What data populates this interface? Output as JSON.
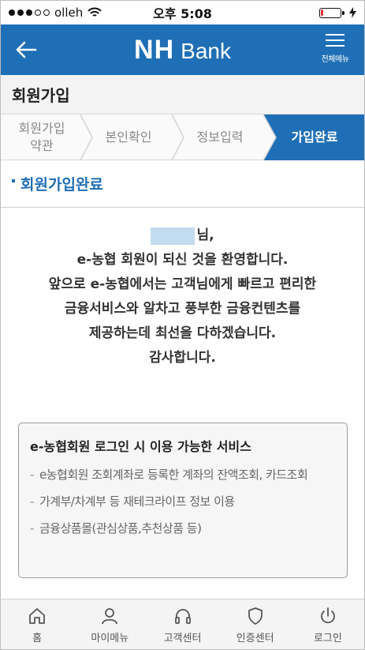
{
  "status_bar": {
    "carrier": "olleh",
    "time": "오후 5:08",
    "signal_filled": 3,
    "signal_total": 5
  },
  "header": {
    "back_icon": "arrow-left-icon",
    "logo_nh": "NH",
    "logo_bank": "Bank",
    "menu_label": "전체메뉴",
    "color": "#1f6fb6"
  },
  "page_title": "회원가입",
  "steps": [
    {
      "label": "회원가입\n약관",
      "active": false
    },
    {
      "label": "본인확인",
      "active": false
    },
    {
      "label": "정보입력",
      "active": false
    },
    {
      "label": "가입완료",
      "active": true
    }
  ],
  "section_title": "회원가입완료",
  "welcome": {
    "name_suffix": "님,",
    "line1": "e-농협 회원이 되신 것을 환영합니다.",
    "line2": "앞으로 e-농협에서는 고객님에게 빠르고 편리한",
    "line3": "금융서비스와 알차고 풍부한 금융컨텐츠를",
    "line4": "제공하는데 최선을 다하겠습니다.",
    "line5": "감사합니다."
  },
  "services": {
    "title": "e-농협회원 로그인 시 이용 가능한 서비스",
    "items": [
      "e농협회원 조회계좌로 등록한 계좌의 잔액조회, 카드조회",
      "가계부/차계부 등 재테크라이프 정보 이용",
      "금융상품몰(관심상품,추천상품 등)"
    ]
  },
  "bottom_nav": [
    {
      "label": "홈",
      "icon": "home-icon"
    },
    {
      "label": "마이메뉴",
      "icon": "person-icon"
    },
    {
      "label": "고객센터",
      "icon": "headset-icon"
    },
    {
      "label": "인증센터",
      "icon": "shield-icon"
    },
    {
      "label": "로그인",
      "icon": "power-icon"
    }
  ]
}
